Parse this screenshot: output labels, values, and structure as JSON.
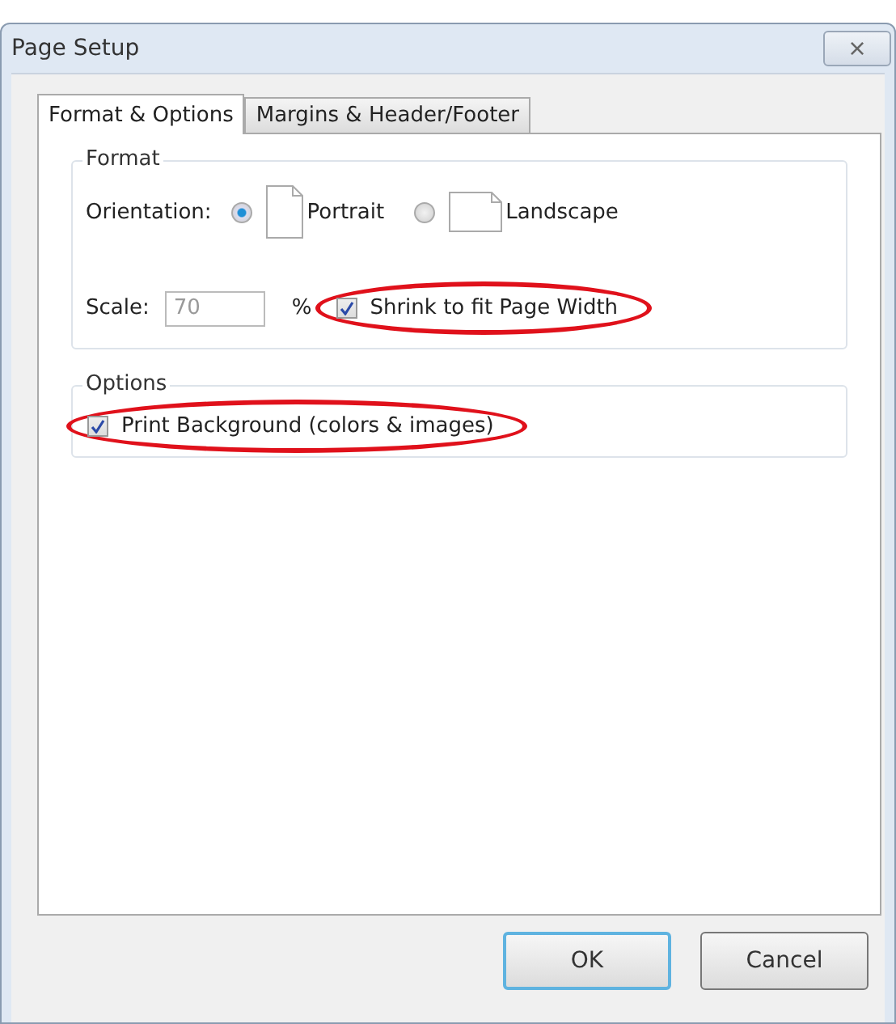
{
  "window": {
    "title": "Page Setup",
    "close": "×"
  },
  "tabs": [
    {
      "label": "Format & Options",
      "selected": true
    },
    {
      "label": "Margins & Header/Footer",
      "selected": false
    }
  ],
  "format": {
    "title": "Format",
    "orientation_label": "Orientation:",
    "orientations": [
      {
        "label": "Portrait",
        "selected": true,
        "kind": "portrait"
      },
      {
        "label": "Landscape",
        "selected": false,
        "kind": "landscape"
      }
    ],
    "scale_label": "Scale:",
    "scale_value": "70",
    "scale_unit": "%",
    "shrink": {
      "label": "Shrink to fit Page Width",
      "checked": true,
      "highlighted": true
    }
  },
  "options": {
    "title": "Options",
    "items": [
      {
        "label": "Print Background (colors & images)",
        "checked": true,
        "highlighted": true
      }
    ]
  },
  "buttons": [
    {
      "label": "OK",
      "default": true
    },
    {
      "label": "Cancel",
      "default": false
    }
  ]
}
